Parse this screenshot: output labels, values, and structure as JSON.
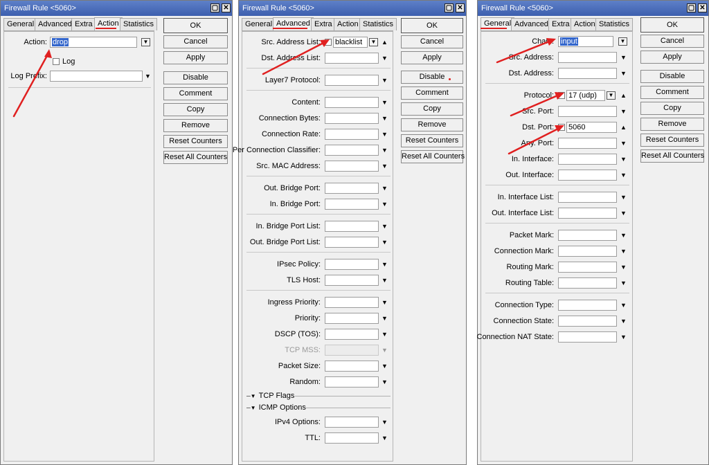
{
  "windows": [
    {
      "title": "Firewall Rule <5060>",
      "tabs": [
        "General",
        "Advanced",
        "Extra",
        "Action",
        "Statistics"
      ],
      "active_tab": "Action",
      "fields": {
        "action_label": "Action:",
        "action_value": "drop",
        "log_label": "Log",
        "log_prefix_label": "Log Prefix:"
      },
      "buttons": [
        "OK",
        "Cancel",
        "Apply",
        "Disable",
        "Comment",
        "Copy",
        "Remove",
        "Reset Counters",
        "Reset All Counters"
      ]
    },
    {
      "title": "Firewall Rule <5060>",
      "tabs": [
        "General",
        "Advanced",
        "Extra",
        "Action",
        "Statistics"
      ],
      "active_tab": "Advanced",
      "fields": {
        "src_address_list_label": "Src. Address List:",
        "src_address_list_value": "blacklist",
        "dst_address_list_label": "Dst. Address List:",
        "layer7_label": "Layer7 Protocol:",
        "content_label": "Content:",
        "connection_bytes_label": "Connection Bytes:",
        "connection_rate_label": "Connection Rate:",
        "per_connection_classifier_label": "Per Connection Classifier:",
        "src_mac_label": "Src. MAC Address:",
        "out_bridge_port_label": "Out. Bridge Port:",
        "in_bridge_port_label": "In. Bridge Port:",
        "in_bridge_port_list_label": "In. Bridge Port List:",
        "out_bridge_port_list_label": "Out. Bridge Port List:",
        "ipsec_policy_label": "IPsec Policy:",
        "tls_host_label": "TLS Host:",
        "ingress_priority_label": "Ingress Priority:",
        "priority_label": "Priority:",
        "dscp_label": "DSCP (TOS):",
        "tcp_mss_label": "TCP MSS:",
        "packet_size_label": "Packet Size:",
        "random_label": "Random:",
        "tcp_flags_section": "TCP Flags",
        "icmp_options_section": "ICMP Options",
        "ipv4_options_label": "IPv4 Options:",
        "ttl_label": "TTL:"
      },
      "buttons": [
        "OK",
        "Cancel",
        "Apply",
        "Disable",
        "Comment",
        "Copy",
        "Remove",
        "Reset Counters",
        "Reset All Counters"
      ]
    },
    {
      "title": "Firewall Rule <5060>",
      "tabs": [
        "General",
        "Advanced",
        "Extra",
        "Action",
        "Statistics"
      ],
      "active_tab": "General",
      "fields": {
        "chain_label": "Chain:",
        "chain_value": "input",
        "src_address_label": "Src. Address:",
        "dst_address_label": "Dst. Address:",
        "protocol_label": "Protocol:",
        "protocol_value": "17 (udp)",
        "src_port_label": "Src. Port:",
        "dst_port_label": "Dst. Port:",
        "dst_port_value": "5060",
        "any_port_label": "Any. Port:",
        "in_interface_label": "In. Interface:",
        "out_interface_label": "Out. Interface:",
        "in_interface_list_label": "In. Interface List:",
        "out_interface_list_label": "Out. Interface List:",
        "packet_mark_label": "Packet Mark:",
        "connection_mark_label": "Connection Mark:",
        "routing_mark_label": "Routing Mark:",
        "routing_table_label": "Routing Table:",
        "connection_type_label": "Connection Type:",
        "connection_state_label": "Connection State:",
        "connection_nat_state_label": "Connection NAT State:"
      },
      "buttons": [
        "OK",
        "Cancel",
        "Apply",
        "Disable",
        "Comment",
        "Copy",
        "Remove",
        "Reset Counters",
        "Reset All Counters"
      ]
    }
  ],
  "icons": {
    "minimize": "window-restore-icon",
    "close": "close-icon",
    "dropdown": "triangle-down-icon",
    "collapse": "triangle-up-icon",
    "annotation_arrow": "red-arrow-icon"
  },
  "colors": {
    "titlebar": "#4a6cb8",
    "annotation": "#e02020",
    "selection": "#3366cc"
  }
}
